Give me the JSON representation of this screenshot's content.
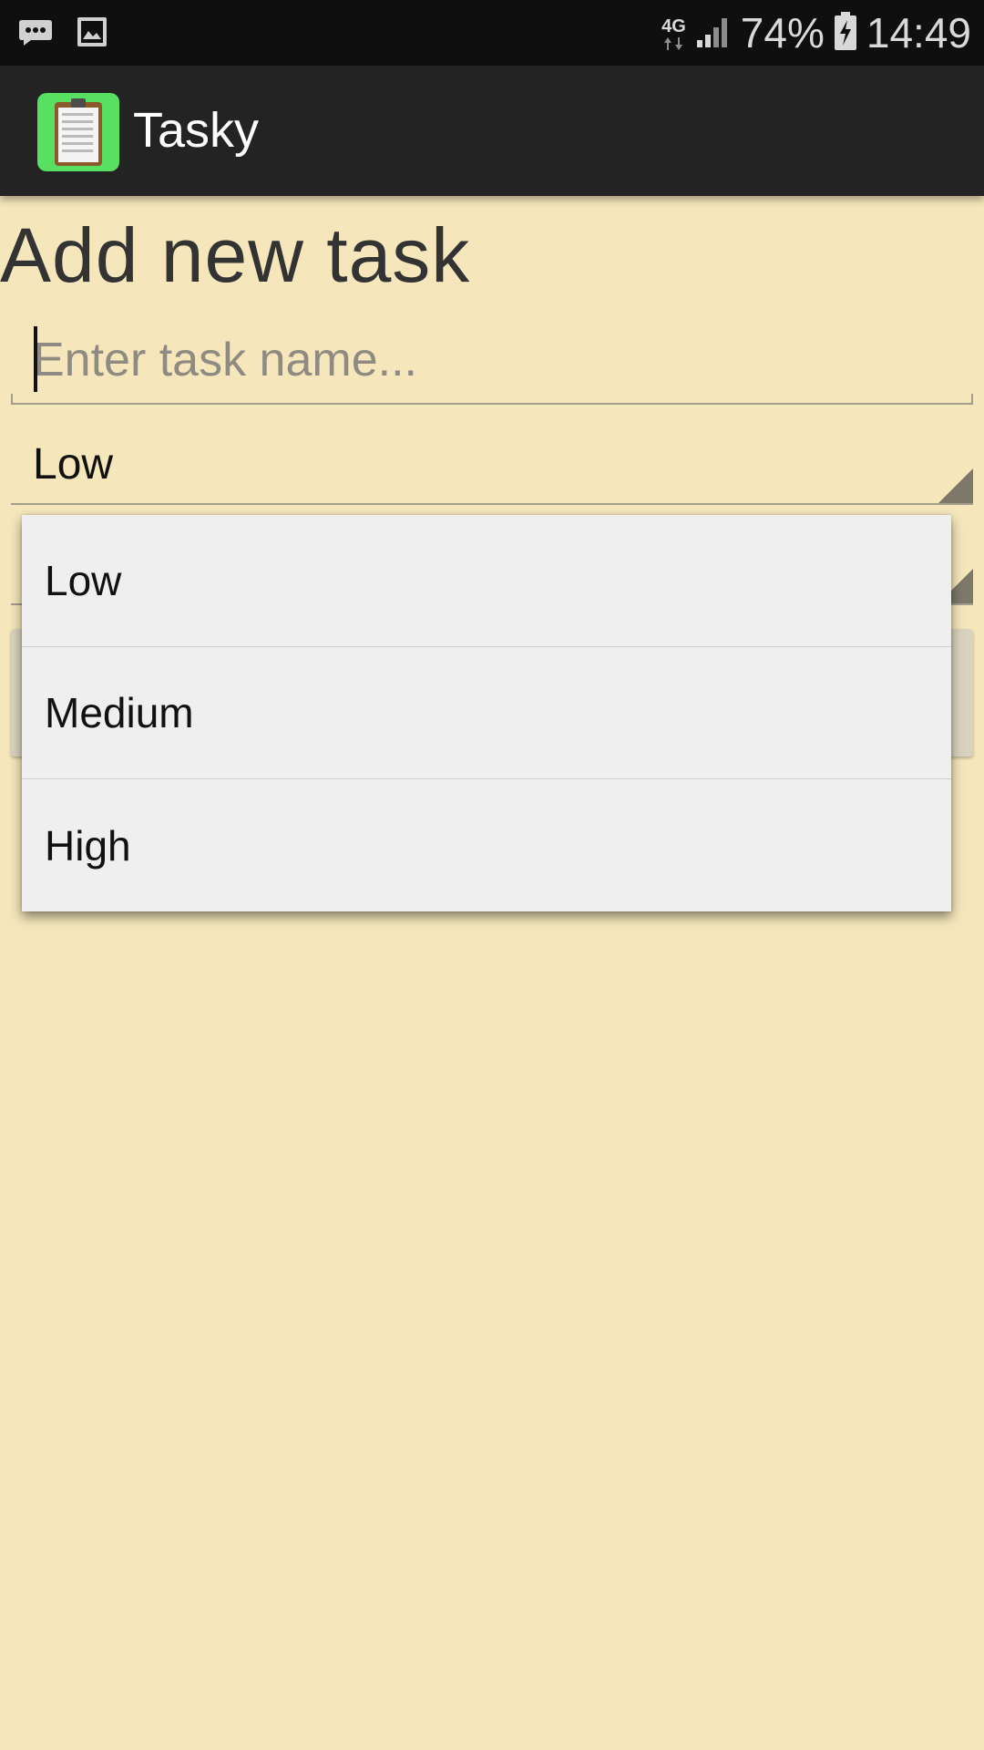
{
  "status_bar": {
    "left_icons": [
      "message-icon",
      "image-icon"
    ],
    "network": "4G",
    "battery_percent": "74%",
    "time": "14:49"
  },
  "app_bar": {
    "title": "Tasky",
    "icon": "clipboard-icon"
  },
  "form": {
    "page_title": "Add new task",
    "task_name_placeholder": "Enter task name...",
    "task_name_value": "",
    "priority_selected": "Low"
  },
  "dropdown": {
    "options": [
      "Low",
      "Medium",
      "High"
    ]
  },
  "colors": {
    "background": "#f5e7bb",
    "status_bar": "#0f0f0f",
    "app_bar": "#232323",
    "app_icon_bg": "#58e062",
    "dropdown_bg": "#efefef"
  }
}
